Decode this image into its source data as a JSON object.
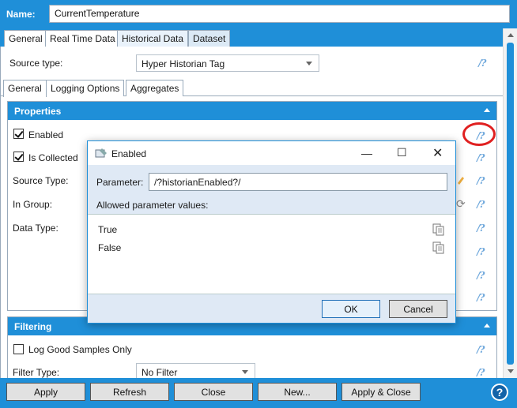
{
  "name_bar": {
    "label": "Name:",
    "value": "CurrentTemperature"
  },
  "top_tabs": [
    "General",
    "Real Time Data",
    "Historical Data",
    "Dataset"
  ],
  "source_type": {
    "label": "Source type:",
    "value": "Hyper Historian Tag"
  },
  "sub_tabs": [
    "General",
    "Logging Options",
    "Aggregates"
  ],
  "properties": {
    "header": "Properties",
    "enabled_label": "Enabled",
    "is_collected_label": "Is Collected",
    "source_type_label": "Source Type:",
    "in_group_label": "In Group:",
    "data_type_label": "Data Type:"
  },
  "filtering": {
    "header": "Filtering",
    "log_good_label": "Log Good Samples Only",
    "filter_type_label": "Filter Type:",
    "filter_type_value": "No Filter"
  },
  "dialog": {
    "title": "Enabled",
    "parameter_label": "Parameter:",
    "parameter_value": "/?historianEnabled?/",
    "allowed_label": "Allowed parameter values:",
    "values": [
      "True",
      "False"
    ],
    "ok_label": "OK",
    "cancel_label": "Cancel"
  },
  "bottom_buttons": [
    "Apply",
    "Refresh",
    "Close",
    "New...",
    "Apply & Close"
  ],
  "help_glyph": "?",
  "help_icon_glyph": "/?",
  "colors": {
    "accent": "#1f8fd8",
    "highlight": "#e02020"
  }
}
